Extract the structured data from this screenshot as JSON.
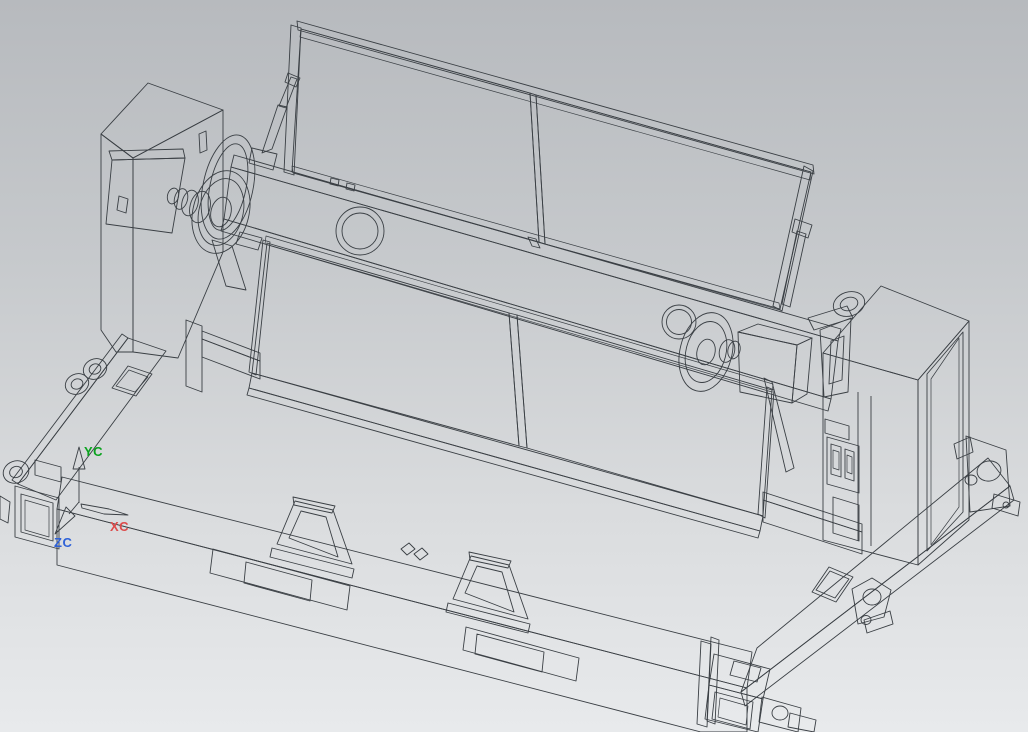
{
  "viewport": {
    "type": "3d-cad-viewport",
    "background": {
      "gradient_top": "#b7babe",
      "gradient_bottom": "#e8eaec"
    },
    "wcs_triad": {
      "x_label": "XC",
      "y_label": "YC",
      "z_label": "ZC",
      "x_color": "#dd4b4b",
      "y_color": "#0aa31e",
      "z_color": "#2f62d8"
    },
    "model": {
      "edge_color": "#3a3f44",
      "face_white": "#f2f4f6",
      "face_light_blue": "#ccd3de",
      "face_mid_gray": "#9ba1a9",
      "face_dark_gray": "#75797f",
      "panel_gray": "#99a0aa"
    }
  }
}
